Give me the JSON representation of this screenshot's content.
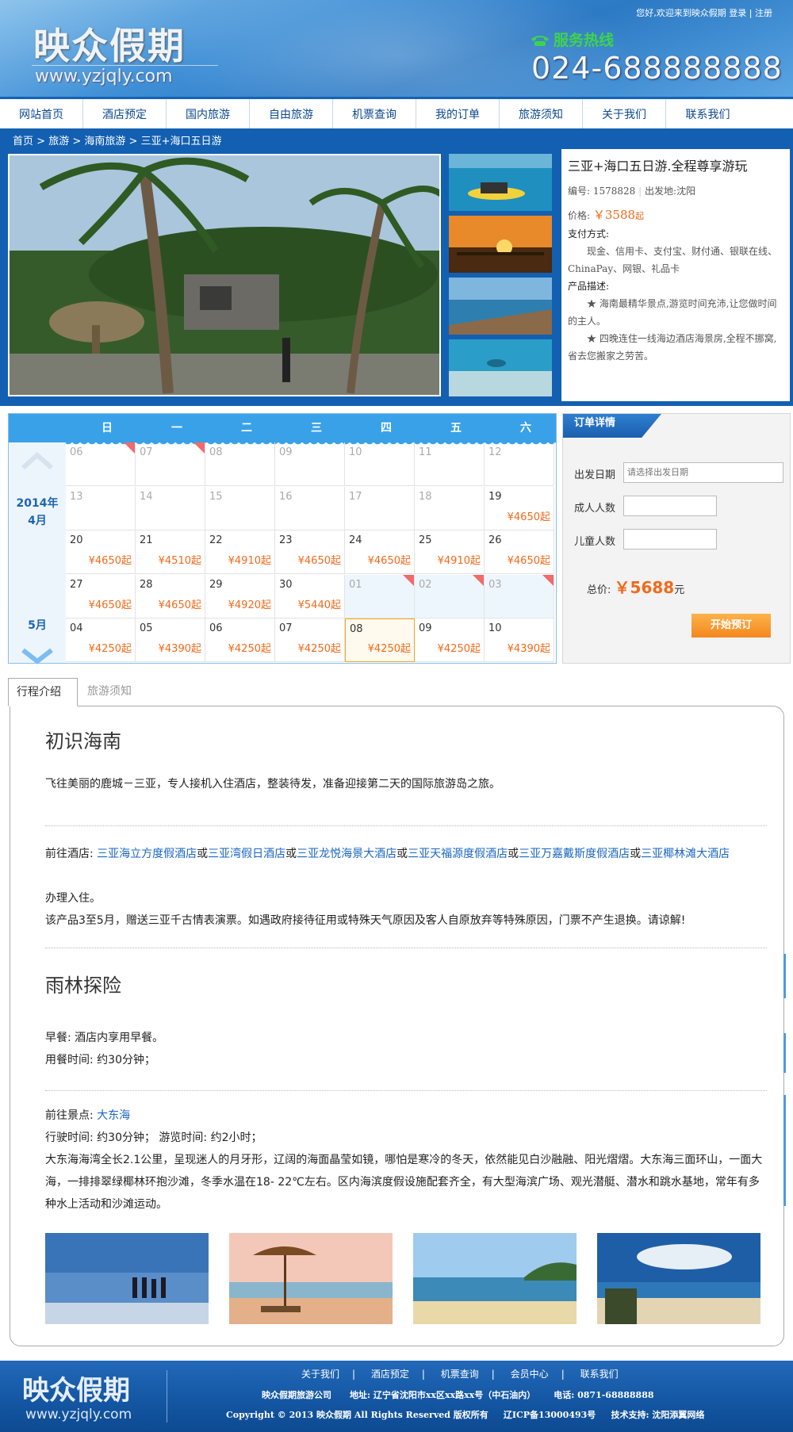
{
  "header": {
    "logo_text": "映众假期",
    "logo_url": "www.yzjqly.com",
    "welcome": "您好,欢迎来到映众假期",
    "login": "登录",
    "register": "注册",
    "hotline_label": "服务热线",
    "hotline_number": "024-688888888"
  },
  "nav": {
    "items": [
      "网站首页",
      "酒店预定",
      "国内旅游",
      "自由旅游",
      "机票查询",
      "我的订单",
      "旅游须知",
      "关于我们",
      "联系我们"
    ]
  },
  "breadcrumb": [
    "首页",
    "旅游",
    "海南旅游",
    "三亚+海口五日游"
  ],
  "product": {
    "title": "三亚+海口五日游.全程尊享游玩",
    "code_label": "编号:",
    "code": "1578828",
    "depart_label": "出发地:",
    "depart": "沈阳",
    "price_label": "价格:",
    "price": "￥3588",
    "price_unit": "起",
    "payment_label": "支付方式:",
    "payment_text": "现金、信用卡、支付宝、财付通、银联在线、ChinaPay、网银、礼品卡",
    "desc_label": "产品描述:",
    "desc_1": "★ 海南最精华景点,游览时间充沛,让您做时间的主人。",
    "desc_2": "★ 四晚连住一线海边酒店海景房,全程不挪窝,省去您搬家之劳苦。"
  },
  "calendar": {
    "weekdays": [
      "日",
      "一",
      "二",
      "三",
      "四",
      "五",
      "六"
    ],
    "month1_year": "2014年",
    "month1": "4月",
    "month2": "5月",
    "rows": [
      [
        {
          "d": "06",
          "p": "",
          "tag": true
        },
        {
          "d": "07",
          "p": "",
          "tag": true
        },
        {
          "d": "08",
          "p": ""
        },
        {
          "d": "09",
          "p": ""
        },
        {
          "d": "10",
          "p": ""
        },
        {
          "d": "11",
          "p": ""
        },
        {
          "d": "12",
          "p": ""
        }
      ],
      [
        {
          "d": "13",
          "p": ""
        },
        {
          "d": "14",
          "p": ""
        },
        {
          "d": "15",
          "p": ""
        },
        {
          "d": "16",
          "p": ""
        },
        {
          "d": "17",
          "p": ""
        },
        {
          "d": "18",
          "p": ""
        },
        {
          "d": "19",
          "p": "¥4650起",
          "act": true
        }
      ],
      [
        {
          "d": "20",
          "p": "¥4650起",
          "act": true
        },
        {
          "d": "21",
          "p": "¥4510起",
          "act": true
        },
        {
          "d": "22",
          "p": "¥4910起",
          "act": true
        },
        {
          "d": "23",
          "p": "¥4650起",
          "act": true
        },
        {
          "d": "24",
          "p": "¥4650起",
          "act": true
        },
        {
          "d": "25",
          "p": "¥4910起",
          "act": true
        },
        {
          "d": "26",
          "p": "¥4650起",
          "act": true
        }
      ],
      [
        {
          "d": "27",
          "p": "¥4650起",
          "act": true
        },
        {
          "d": "28",
          "p": "¥4650起",
          "act": true
        },
        {
          "d": "29",
          "p": "¥4920起",
          "act": true
        },
        {
          "d": "30",
          "p": "¥5440起",
          "act": true
        },
        {
          "d": "01",
          "p": "",
          "next": true,
          "tag": true
        },
        {
          "d": "02",
          "p": "",
          "next": true,
          "tag": true
        },
        {
          "d": "03",
          "p": "",
          "next": true,
          "tag": true
        }
      ],
      [
        {
          "d": "04",
          "p": "¥4250起",
          "act": true
        },
        {
          "d": "05",
          "p": "¥4390起",
          "act": true
        },
        {
          "d": "06",
          "p": "¥4250起",
          "act": true
        },
        {
          "d": "07",
          "p": "¥4250起",
          "act": true
        },
        {
          "d": "08",
          "p": "¥4250起",
          "act": true,
          "sel": true
        },
        {
          "d": "09",
          "p": "¥4250起",
          "act": true
        },
        {
          "d": "10",
          "p": "¥4390起",
          "act": true
        }
      ]
    ]
  },
  "order": {
    "tab": "订单详情",
    "date_label": "出发日期",
    "date_placeholder": "请选择出发日期",
    "adult_label": "成人人数",
    "child_label": "儿童人数",
    "total_label": "总价:",
    "total_value": "￥5688",
    "total_unit": "元",
    "book_button": "开始预订"
  },
  "tabs": [
    "行程介绍",
    "旅游须知"
  ],
  "itinerary": {
    "day1_title": "初识海南",
    "day1_text": "飞往美丽的鹿城－三亚，专人接机入住酒店，整装待发，准备迎接第二天的国际旅游岛之旅。",
    "hotel_label": "前往酒店: ",
    "hotels": [
      "三亚海立方度假酒店",
      "三亚湾假日酒店",
      "三亚龙悦海景大酒店",
      "三亚天福源度假酒店",
      "三亚万嘉戴斯度假酒店",
      "三亚椰林滩大酒店"
    ],
    "or": "或",
    "checkin": "办理入住。",
    "note": "该产品3至5月，赠送三亚千古情表演票。如遇政府接待征用或特殊天气原因及客人自原放弃等特殊原因，门票不产生退换。请谅解!",
    "day2_title": "雨林探险",
    "breakfast": "早餐: 酒店内享用早餐。",
    "meal_time": "用餐时间: 约30分钟；",
    "spot_label": "前往景点: ",
    "spot": "大东海",
    "travel_time": "行驶时间: 约30分钟； 游览时间: 约2小时；",
    "spot_desc": "大东海海湾全长2.1公里，呈现迷人的月牙形，辽阔的海面晶莹如镜，哪怕是寒冷的冬天，依然能见白沙融融、阳光熠熠。大东海三面环山，一面大海，一排排翠绿椰林环抱沙滩，冬季水温在18- 22℃左右。区内海滨度假设施配套齐全，有大型海滨广场、观光潜艇、潜水和跳水基地，常年有多种水上活动和沙滩运动。"
  },
  "footer": {
    "logo_text": "映众假期",
    "logo_url": "www.yzjqly.com",
    "links": [
      "关于我们",
      "酒店预定",
      "机票查询",
      "会员中心",
      "联系我们"
    ],
    "link_sep": "|",
    "company": "映众假期旅游公司",
    "address": "地址: 辽宁省沈阳市xx区xx路xx号（中石油内）",
    "phone": "电话: 0871-68888888",
    "copyright": "Copyright © 2013 映众假期 All Rights Reserved 版权所有",
    "icp": "辽ICP备13000493号",
    "support": "技术支持: 沈阳添翼网络"
  }
}
